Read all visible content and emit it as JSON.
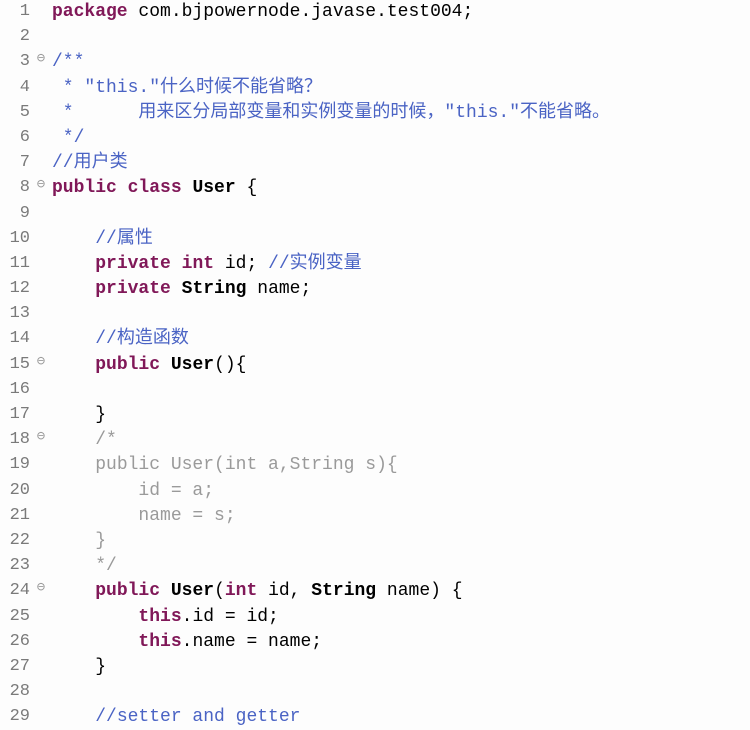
{
  "lines": [
    {
      "n": 1,
      "fold": "",
      "tokens": [
        [
          "kw",
          "package"
        ],
        [
          "id",
          " com.bjpowernode.javase.test004;"
        ]
      ]
    },
    {
      "n": 2,
      "fold": "",
      "tokens": []
    },
    {
      "n": 3,
      "fold": "⊖",
      "tokens": [
        [
          "jdoc",
          "/**"
        ]
      ]
    },
    {
      "n": 4,
      "fold": "",
      "tokens": [
        [
          "jdoc",
          " * \"this.\"什么时候不能省略？"
        ]
      ]
    },
    {
      "n": 5,
      "fold": "",
      "tokens": [
        [
          "jdoc",
          " *      用来区分局部变量和实例变量的时候，\"this.\"不能省略。"
        ]
      ]
    },
    {
      "n": 6,
      "fold": "",
      "tokens": [
        [
          "jdoc",
          " */"
        ]
      ]
    },
    {
      "n": 7,
      "fold": "",
      "tokens": [
        [
          "com",
          "//用户类"
        ]
      ]
    },
    {
      "n": 8,
      "fold": "⊖",
      "tokens": [
        [
          "kw",
          "public"
        ],
        [
          "id",
          " "
        ],
        [
          "kw",
          "class"
        ],
        [
          "id",
          " "
        ],
        [
          "cls",
          "User"
        ],
        [
          "id",
          " {"
        ]
      ]
    },
    {
      "n": 9,
      "fold": "",
      "tokens": []
    },
    {
      "n": 10,
      "fold": "",
      "tokens": [
        [
          "id",
          "    "
        ],
        [
          "com",
          "//属性"
        ]
      ]
    },
    {
      "n": 11,
      "fold": "",
      "tokens": [
        [
          "id",
          "    "
        ],
        [
          "kw",
          "private"
        ],
        [
          "id",
          " "
        ],
        [
          "kw",
          "int"
        ],
        [
          "id",
          " id; "
        ],
        [
          "com",
          "//实例变量"
        ]
      ]
    },
    {
      "n": 12,
      "fold": "",
      "tokens": [
        [
          "id",
          "    "
        ],
        [
          "kw",
          "private"
        ],
        [
          "id",
          " "
        ],
        [
          "typ",
          "String"
        ],
        [
          "id",
          " name;"
        ]
      ]
    },
    {
      "n": 13,
      "fold": "",
      "tokens": []
    },
    {
      "n": 14,
      "fold": "",
      "tokens": [
        [
          "id",
          "    "
        ],
        [
          "com",
          "//构造函数"
        ]
      ]
    },
    {
      "n": 15,
      "fold": "⊖",
      "tokens": [
        [
          "id",
          "    "
        ],
        [
          "kw",
          "public"
        ],
        [
          "id",
          " "
        ],
        [
          "mtd",
          "User"
        ],
        [
          "id",
          "(){"
        ]
      ]
    },
    {
      "n": 16,
      "fold": "",
      "tokens": []
    },
    {
      "n": 17,
      "fold": "",
      "tokens": [
        [
          "id",
          "    }"
        ]
      ]
    },
    {
      "n": 18,
      "fold": "⊖",
      "tokens": [
        [
          "id",
          "    "
        ],
        [
          "gray",
          "/*"
        ]
      ]
    },
    {
      "n": 19,
      "fold": "",
      "tokens": [
        [
          "id",
          "    "
        ],
        [
          "gray",
          "public User(int a,String s){"
        ]
      ]
    },
    {
      "n": 20,
      "fold": "",
      "tokens": [
        [
          "id",
          "        "
        ],
        [
          "gray",
          "id = a;"
        ]
      ]
    },
    {
      "n": 21,
      "fold": "",
      "tokens": [
        [
          "id",
          "        "
        ],
        [
          "gray",
          "name = s;"
        ]
      ]
    },
    {
      "n": 22,
      "fold": "",
      "tokens": [
        [
          "id",
          "    "
        ],
        [
          "gray",
          "}"
        ]
      ]
    },
    {
      "n": 23,
      "fold": "",
      "tokens": [
        [
          "id",
          "    "
        ],
        [
          "gray",
          "*/"
        ]
      ]
    },
    {
      "n": 24,
      "fold": "⊖",
      "tokens": [
        [
          "id",
          "    "
        ],
        [
          "kw",
          "public"
        ],
        [
          "id",
          " "
        ],
        [
          "mtd",
          "User"
        ],
        [
          "id",
          "("
        ],
        [
          "kw",
          "int"
        ],
        [
          "id",
          " id, "
        ],
        [
          "typ",
          "String"
        ],
        [
          "id",
          " name) {"
        ]
      ]
    },
    {
      "n": 25,
      "fold": "",
      "tokens": [
        [
          "id",
          "        "
        ],
        [
          "kw",
          "this"
        ],
        [
          "id",
          ".id = id;"
        ]
      ]
    },
    {
      "n": 26,
      "fold": "",
      "tokens": [
        [
          "id",
          "        "
        ],
        [
          "kw",
          "this"
        ],
        [
          "id",
          ".name = name;"
        ]
      ]
    },
    {
      "n": 27,
      "fold": "",
      "tokens": [
        [
          "id",
          "    }"
        ]
      ]
    },
    {
      "n": 28,
      "fold": "",
      "tokens": []
    },
    {
      "n": 29,
      "fold": "",
      "tokens": [
        [
          "id",
          "    "
        ],
        [
          "com",
          "//setter and getter"
        ]
      ]
    }
  ]
}
